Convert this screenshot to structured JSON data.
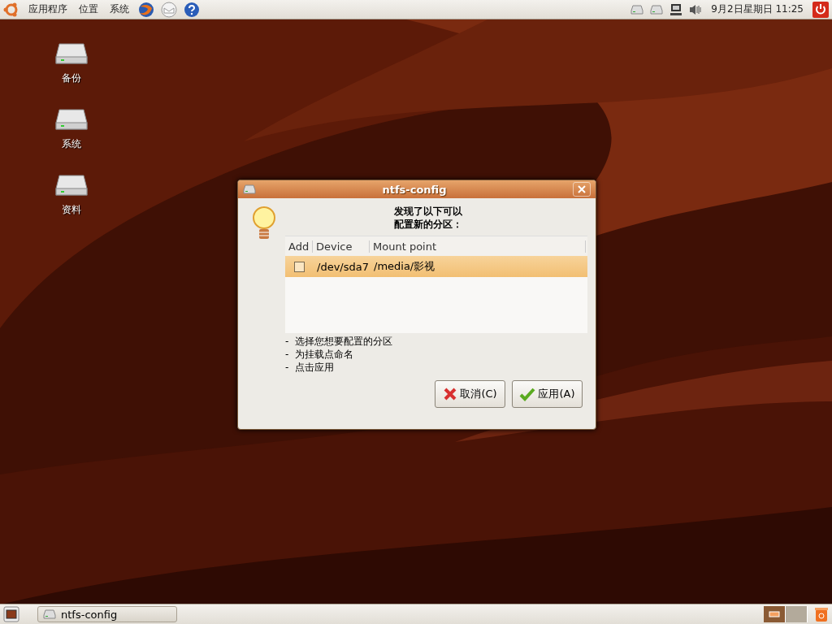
{
  "top_panel": {
    "menus": [
      "应用程序",
      "位置",
      "系统"
    ],
    "clock": "9月2日星期日 11:25"
  },
  "desktop_icons": [
    {
      "label": "备份"
    },
    {
      "label": "系统"
    },
    {
      "label": "资料"
    }
  ],
  "dialog": {
    "title": "ntfs-config",
    "heading": [
      "发现了以下可以",
      "配置新的分区："
    ],
    "table": {
      "columns": [
        "Add",
        "Device",
        "Mount point"
      ],
      "rows": [
        {
          "checked": false,
          "selected": true,
          "device": "/dev/sda7",
          "mount_point": "/media/影视"
        }
      ]
    },
    "instructions": [
      "-  选择您想要配置的分区",
      "-  为挂载点命名",
      "-  点击应用"
    ],
    "buttons": [
      {
        "kind": "cancel",
        "label": "取消(C)"
      },
      {
        "kind": "apply",
        "label": "应用(A)"
      }
    ]
  },
  "bottom_panel": {
    "tasks": [
      {
        "label": "ntfs-config"
      }
    ],
    "workspaces": [
      {
        "selected": true
      },
      {
        "selected": false
      }
    ]
  }
}
